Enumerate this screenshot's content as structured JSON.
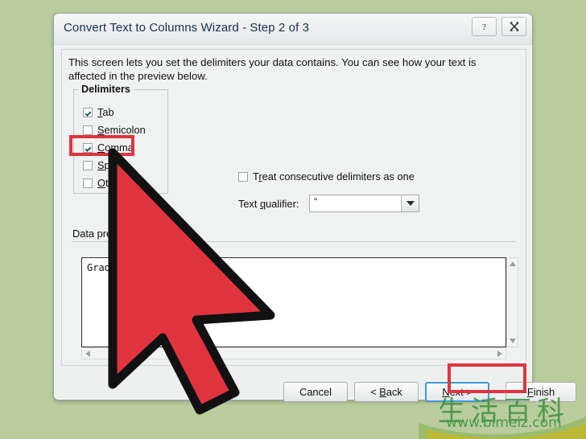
{
  "window": {
    "title": "Convert Text to Columns Wizard - Step 2 of 3",
    "help_icon": "?",
    "close_icon": "close-icon"
  },
  "content": {
    "intro": "This screen lets you set the delimiters your data contains.  You can see how your text is affected in the preview below."
  },
  "delimiters": {
    "legend": "Delimiters",
    "items": [
      {
        "label": "Tab",
        "checked": true,
        "accel": "T"
      },
      {
        "label": "Semicolon",
        "checked": false,
        "accel": "S"
      },
      {
        "label": "Comma",
        "checked": true,
        "accel": "C"
      },
      {
        "label": "Space",
        "checked": false,
        "accel": "S"
      },
      {
        "label": "Other:",
        "checked": false,
        "accel": "O"
      }
    ],
    "other_value": ""
  },
  "options": {
    "consecutive_label": "Treat consecutive delimiters as one",
    "consecutive_checked": false,
    "qualifier_label": "Text qualifier:",
    "qualifier_value": "\""
  },
  "preview": {
    "label": "Data preview",
    "text": "Grade"
  },
  "buttons": {
    "cancel": "Cancel",
    "back": "< Back",
    "next": "Next >",
    "finish": "Finish"
  },
  "annotations": {
    "highlight_color": "#e0343f",
    "cursor_color": "#e0343f",
    "cursor_outline": "#111111"
  },
  "watermark": {
    "cn_text": "生活百科",
    "url": "www.bimeiz.com",
    "color": "#3f8f3f"
  },
  "theme": {
    "desktop_background": "#b9cc9c",
    "dialog_background": "#eef0f0",
    "title_color": "#16324f",
    "focus_border": "#3d9ad6"
  }
}
